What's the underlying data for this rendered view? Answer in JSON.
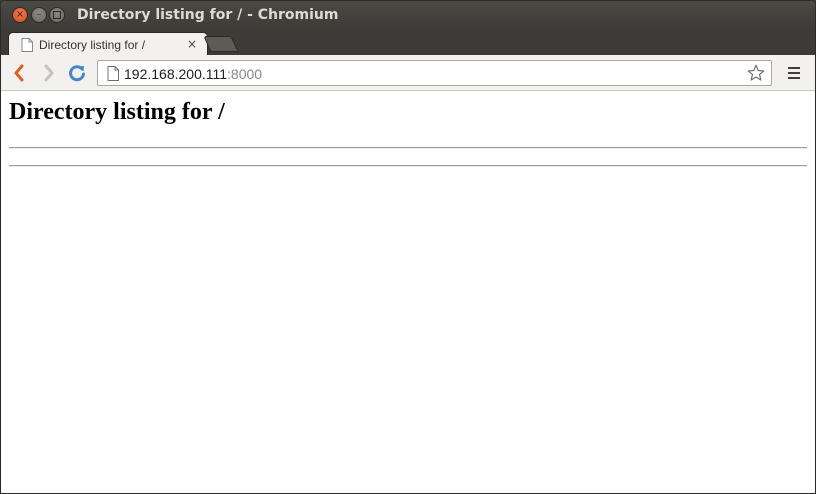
{
  "window": {
    "title": "Directory listing for / - Chromium"
  },
  "tabs": [
    {
      "label": "Directory listing for /",
      "close_glyph": "×",
      "active": true
    }
  ],
  "toolbar": {
    "url_host": "192.168.200.111",
    "url_port": ":8000"
  },
  "page": {
    "heading": "Directory listing for /",
    "entries": []
  },
  "colors": {
    "titlebar": "#3c3b37",
    "close_button": "#e0592b",
    "toolbar": "#f2f1f0",
    "reload_blue": "#4a86c5",
    "back_orange": "#e0601e"
  }
}
